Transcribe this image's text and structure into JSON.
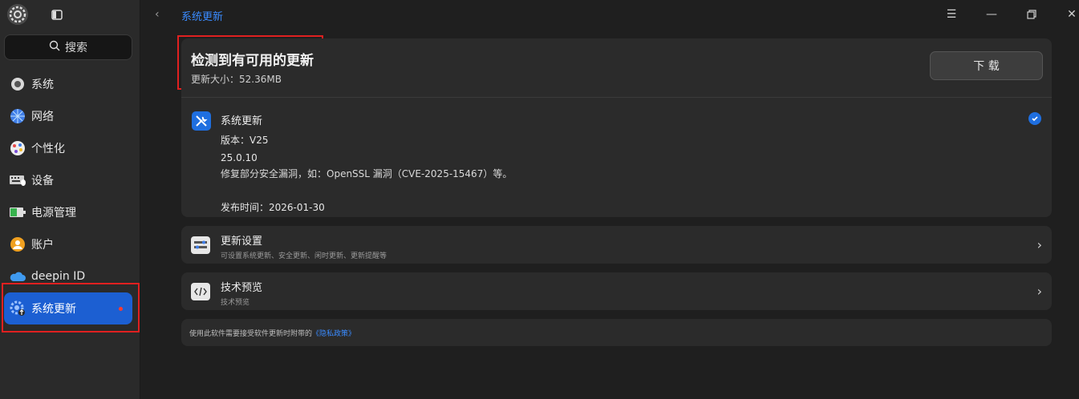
{
  "window": {
    "title": "系统更新"
  },
  "search": {
    "label": "搜索"
  },
  "sidebar": {
    "items": [
      {
        "label": "系统",
        "icon": "system-icon"
      },
      {
        "label": "网络",
        "icon": "network-icon"
      },
      {
        "label": "个性化",
        "icon": "personalization-icon"
      },
      {
        "label": "设备",
        "icon": "device-icon"
      },
      {
        "label": "电源管理",
        "icon": "power-icon"
      },
      {
        "label": "账户",
        "icon": "account-icon"
      },
      {
        "label": "deepin ID",
        "icon": "cloud-icon"
      },
      {
        "label": "系统更新",
        "icon": "update-gear-icon",
        "active": true
      }
    ]
  },
  "update": {
    "heading": "检测到有可用的更新",
    "size": "更新大小：52.36MB",
    "download_label": "下 载",
    "item": {
      "name": "系统更新",
      "version": "版本：V25",
      "number": "25.0.10",
      "description": "修复部分安全漏洞，如：OpenSSL 漏洞（CVE-2025-15467）等。",
      "release": "发布时间：2026-01-30"
    }
  },
  "settings_row": {
    "title": "更新设置",
    "subtitle": "可设置系统更新、安全更新、闲时更新、更新提醒等"
  },
  "preview_row": {
    "title": "技术预览",
    "subtitle": "技术预览"
  },
  "footer": {
    "text": "使用此软件需要接受软件更新时附带的",
    "link": "《隐私政策》"
  },
  "colors": {
    "accent": "#1c5fd2",
    "link": "#3a8bff",
    "highlight": "#e02020"
  }
}
